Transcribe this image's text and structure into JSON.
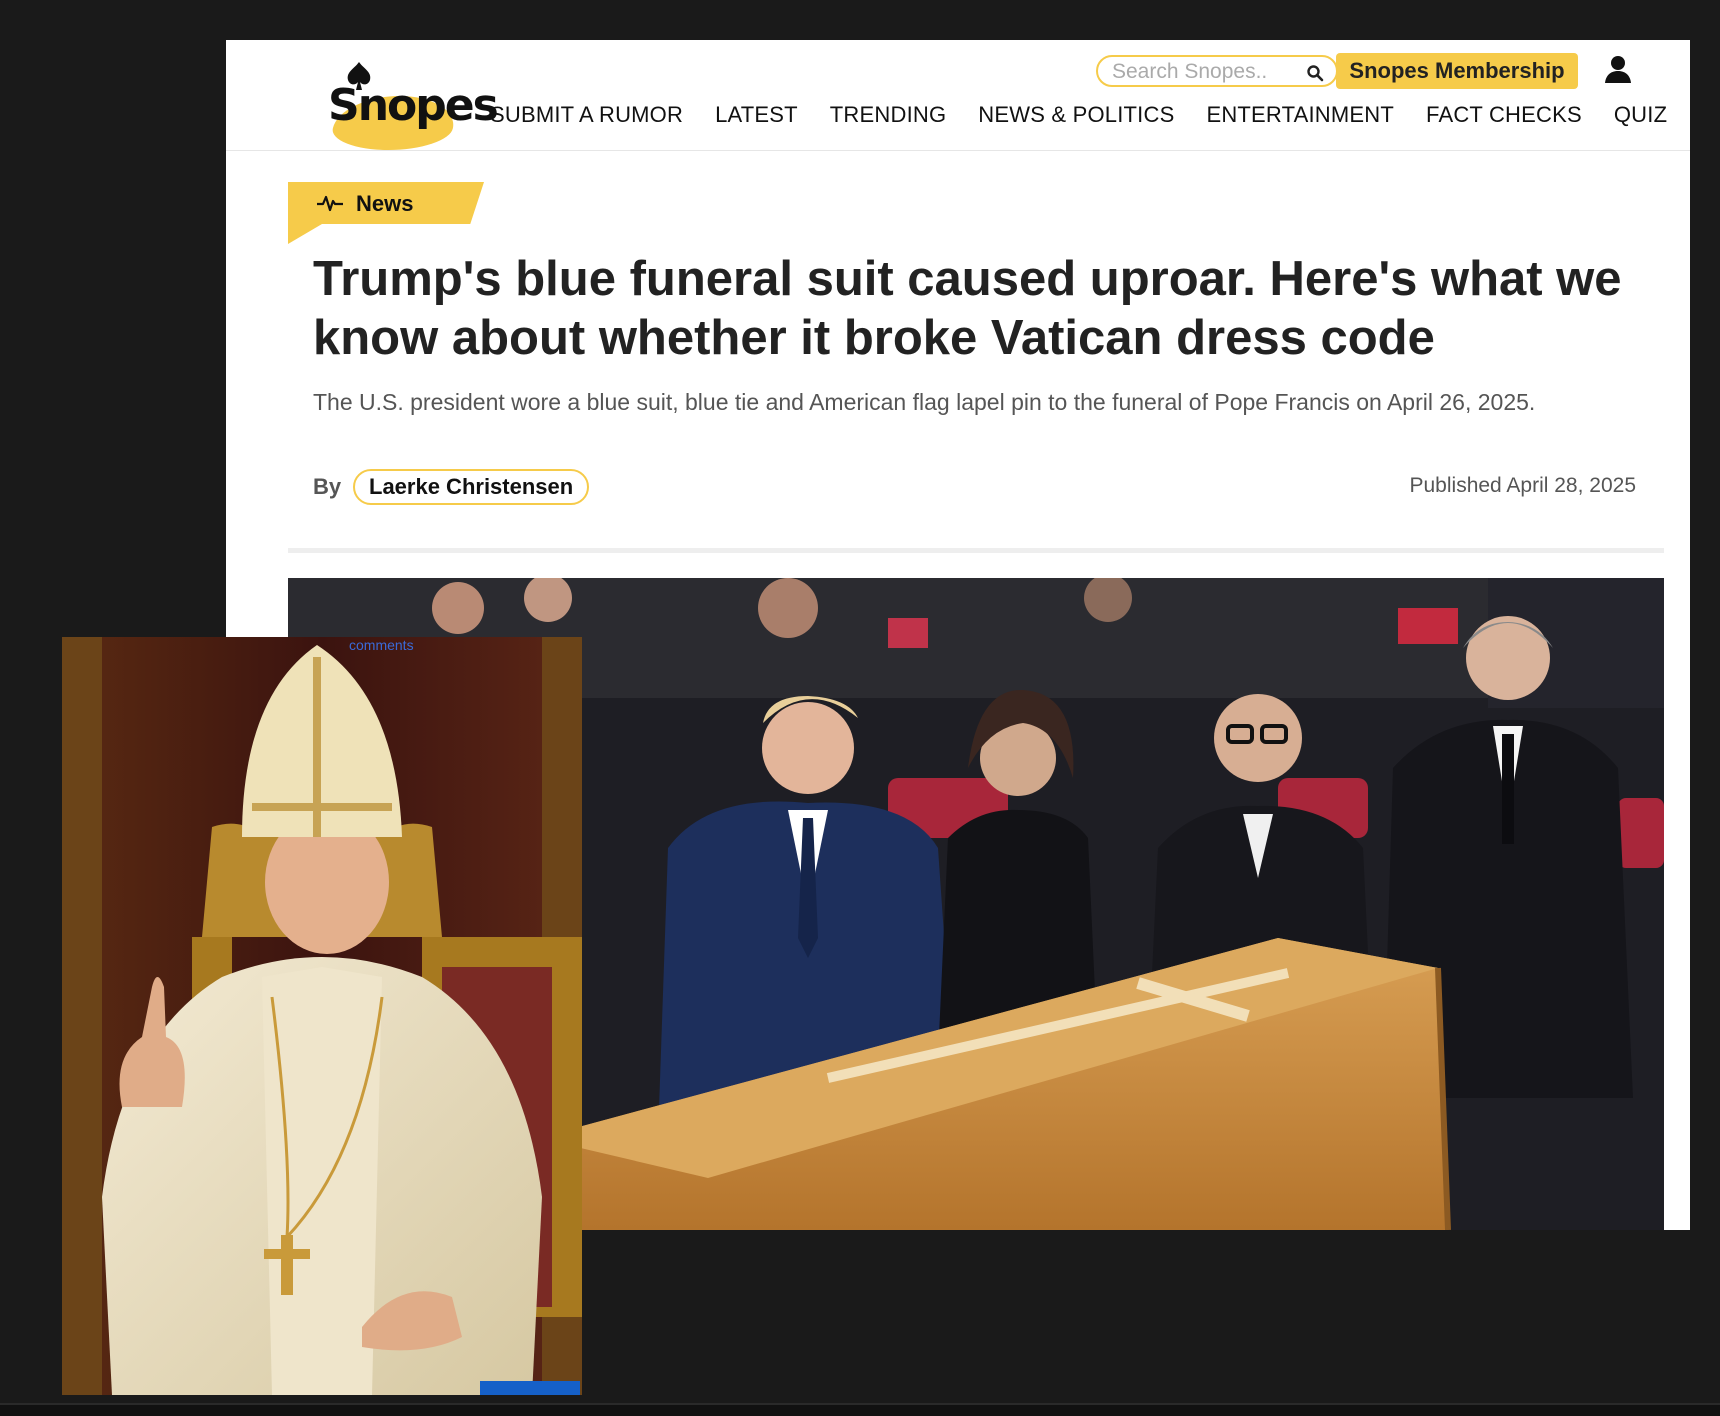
{
  "site": {
    "logo_text": "Snopes",
    "search_placeholder": "Search Snopes..",
    "membership_label": "Snopes Membership",
    "nav": [
      "SUBMIT A RUMOR",
      "LATEST",
      "TRENDING",
      "NEWS & POLITICS",
      "ENTERTAINMENT",
      "FACT CHECKS",
      "QUIZ"
    ]
  },
  "article": {
    "tag": "News",
    "headline": "Trump's blue funeral suit caused uproar. Here's what we know about whether it broke Vatican dress code",
    "dek": "The U.S. president wore a blue suit, blue tie and American flag lapel pin to the funeral of Pope Francis on April 26, 2025.",
    "byline_label": "By",
    "author": "Laerke Christensen",
    "published": "Published April 28, 2025"
  },
  "overlay": {
    "comments_label": "comments"
  },
  "colors": {
    "accent": "#f6cb4a",
    "background": "#1a1a1a",
    "page": "#ffffff"
  },
  "icons": [
    "search-icon",
    "user-icon",
    "pulse-icon",
    "spade-icon"
  ]
}
